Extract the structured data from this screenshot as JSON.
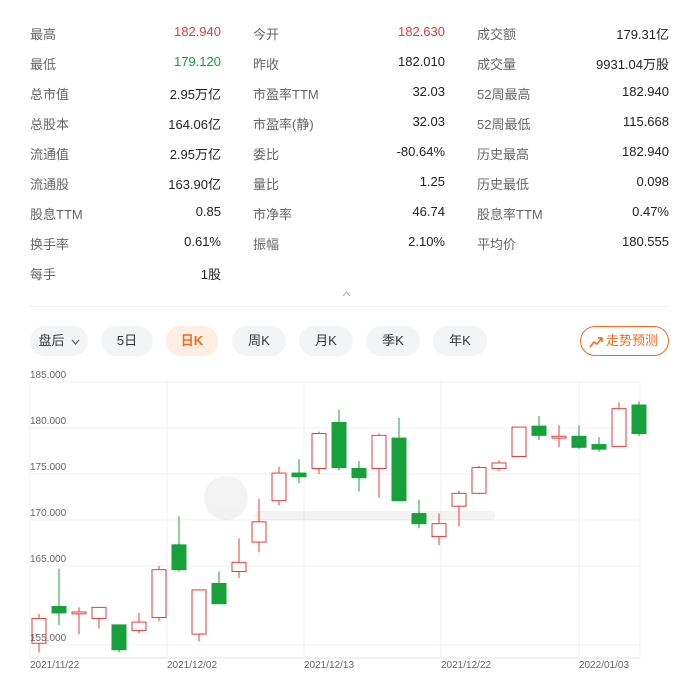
{
  "stats": {
    "rows": [
      [
        {
          "label": "最高",
          "value": "182.940",
          "tone": "up"
        },
        {
          "label": "今开",
          "value": "182.630",
          "tone": "up"
        },
        {
          "label": "成交额",
          "value": "179.31亿",
          "tone": ""
        }
      ],
      [
        {
          "label": "最低",
          "value": "179.120",
          "tone": "down"
        },
        {
          "label": "昨收",
          "value": "182.010",
          "tone": ""
        },
        {
          "label": "成交量",
          "value": "9931.04万股",
          "tone": ""
        }
      ],
      [
        {
          "label": "总市值",
          "value": "2.95万亿",
          "tone": ""
        },
        {
          "label": "市盈率TTM",
          "value": "32.03",
          "tone": ""
        },
        {
          "label": "52周最高",
          "value": "182.940",
          "tone": ""
        }
      ],
      [
        {
          "label": "总股本",
          "value": "164.06亿",
          "tone": ""
        },
        {
          "label": "市盈率(静)",
          "value": "32.03",
          "tone": ""
        },
        {
          "label": "52周最低",
          "value": "115.668",
          "tone": ""
        }
      ],
      [
        {
          "label": "流通值",
          "value": "2.95万亿",
          "tone": ""
        },
        {
          "label": "委比",
          "value": "-80.64%",
          "tone": ""
        },
        {
          "label": "历史最高",
          "value": "182.940",
          "tone": ""
        }
      ],
      [
        {
          "label": "流通股",
          "value": "163.90亿",
          "tone": ""
        },
        {
          "label": "量比",
          "value": "1.25",
          "tone": ""
        },
        {
          "label": "历史最低",
          "value": "0.098",
          "tone": ""
        }
      ],
      [
        {
          "label": "股息TTM",
          "value": "0.85",
          "tone": ""
        },
        {
          "label": "市净率",
          "value": "46.74",
          "tone": ""
        },
        {
          "label": "股息率TTM",
          "value": "0.47%",
          "tone": ""
        }
      ],
      [
        {
          "label": "换手率",
          "value": "0.61%",
          "tone": ""
        },
        {
          "label": "振幅",
          "value": "2.10%",
          "tone": ""
        },
        {
          "label": "平均价",
          "value": "180.555",
          "tone": ""
        }
      ],
      [
        {
          "label": "每手",
          "value": "1股",
          "tone": ""
        }
      ]
    ]
  },
  "tabs": {
    "select_label": "盘后",
    "items": [
      "5日",
      "日K",
      "周K",
      "月K",
      "季K",
      "年K"
    ],
    "active": "日K",
    "forecast_label": "走势预测"
  },
  "colors": {
    "up": "#e63d3d",
    "down": "#17a03b",
    "accent": "#f26b1d"
  },
  "chart_data": {
    "type": "candlestick",
    "y_ticks": [
      "185.000",
      "180.000",
      "175.000",
      "170.000",
      "165.000",
      "155.000"
    ],
    "ylim": [
      155,
      185
    ],
    "x_ticks": [
      "2021/11/22",
      "2021/12/02",
      "2021/12/13",
      "2021/12/22",
      "2022/01/03"
    ],
    "candles": [
      {
        "open": 156.6,
        "close": 159.3,
        "high": 159.8,
        "low": 155.6
      },
      {
        "open": 160.6,
        "close": 159.9,
        "high": 164.7,
        "low": 158.6
      },
      {
        "open": 159.8,
        "close": 160.0,
        "high": 160.5,
        "low": 157.6
      },
      {
        "open": 159.3,
        "close": 160.5,
        "high": 160.5,
        "low": 158.2
      },
      {
        "open": 158.6,
        "close": 155.9,
        "high": 158.6,
        "low": 155.6
      },
      {
        "open": 158.0,
        "close": 158.9,
        "high": 159.9,
        "low": 157.7
      },
      {
        "open": 159.4,
        "close": 164.6,
        "high": 165.0,
        "low": 159.0
      },
      {
        "open": 167.3,
        "close": 164.6,
        "high": 170.4,
        "low": 164.4
      },
      {
        "open": 157.6,
        "close": 162.4,
        "high": 162.4,
        "low": 156.8
      },
      {
        "open": 163.1,
        "close": 160.9,
        "high": 164.4,
        "low": 160.9
      },
      {
        "open": 164.4,
        "close": 165.4,
        "high": 168.0,
        "low": 163.7
      },
      {
        "open": 167.6,
        "close": 169.8,
        "high": 172.3,
        "low": 166.5
      },
      {
        "open": 172.1,
        "close": 175.1,
        "high": 175.8,
        "low": 171.6
      },
      {
        "open": 175.1,
        "close": 174.7,
        "high": 176.6,
        "low": 174.0
      },
      {
        "open": 175.6,
        "close": 179.4,
        "high": 179.6,
        "low": 175.0
      },
      {
        "open": 180.6,
        "close": 175.7,
        "high": 182.0,
        "low": 175.4
      },
      {
        "open": 175.6,
        "close": 174.6,
        "high": 176.4,
        "low": 173.1
      },
      {
        "open": 175.6,
        "close": 179.2,
        "high": 179.4,
        "low": 172.4
      },
      {
        "open": 178.9,
        "close": 172.1,
        "high": 181.1,
        "low": 172.1
      },
      {
        "open": 170.7,
        "close": 169.6,
        "high": 172.2,
        "low": 169.1
      },
      {
        "open": 168.2,
        "close": 169.6,
        "high": 170.7,
        "low": 167.3
      },
      {
        "open": 171.5,
        "close": 172.9,
        "high": 173.2,
        "low": 169.3
      },
      {
        "open": 172.9,
        "close": 175.7,
        "high": 175.9,
        "low": 172.8
      },
      {
        "open": 175.6,
        "close": 176.2,
        "high": 176.5,
        "low": 175.3
      },
      {
        "open": 176.9,
        "close": 180.1,
        "high": 180.1,
        "low": 176.9
      },
      {
        "open": 180.2,
        "close": 179.2,
        "high": 181.3,
        "low": 178.7
      },
      {
        "open": 178.9,
        "close": 179.1,
        "high": 180.3,
        "low": 177.9
      },
      {
        "open": 179.1,
        "close": 177.9,
        "high": 180.3,
        "low": 177.7
      },
      {
        "open": 178.2,
        "close": 177.7,
        "high": 179.0,
        "low": 177.4
      },
      {
        "open": 178.0,
        "close": 182.1,
        "high": 182.8,
        "low": 178.0
      },
      {
        "open": 182.5,
        "close": 179.4,
        "high": 182.9,
        "low": 179.1
      }
    ]
  }
}
